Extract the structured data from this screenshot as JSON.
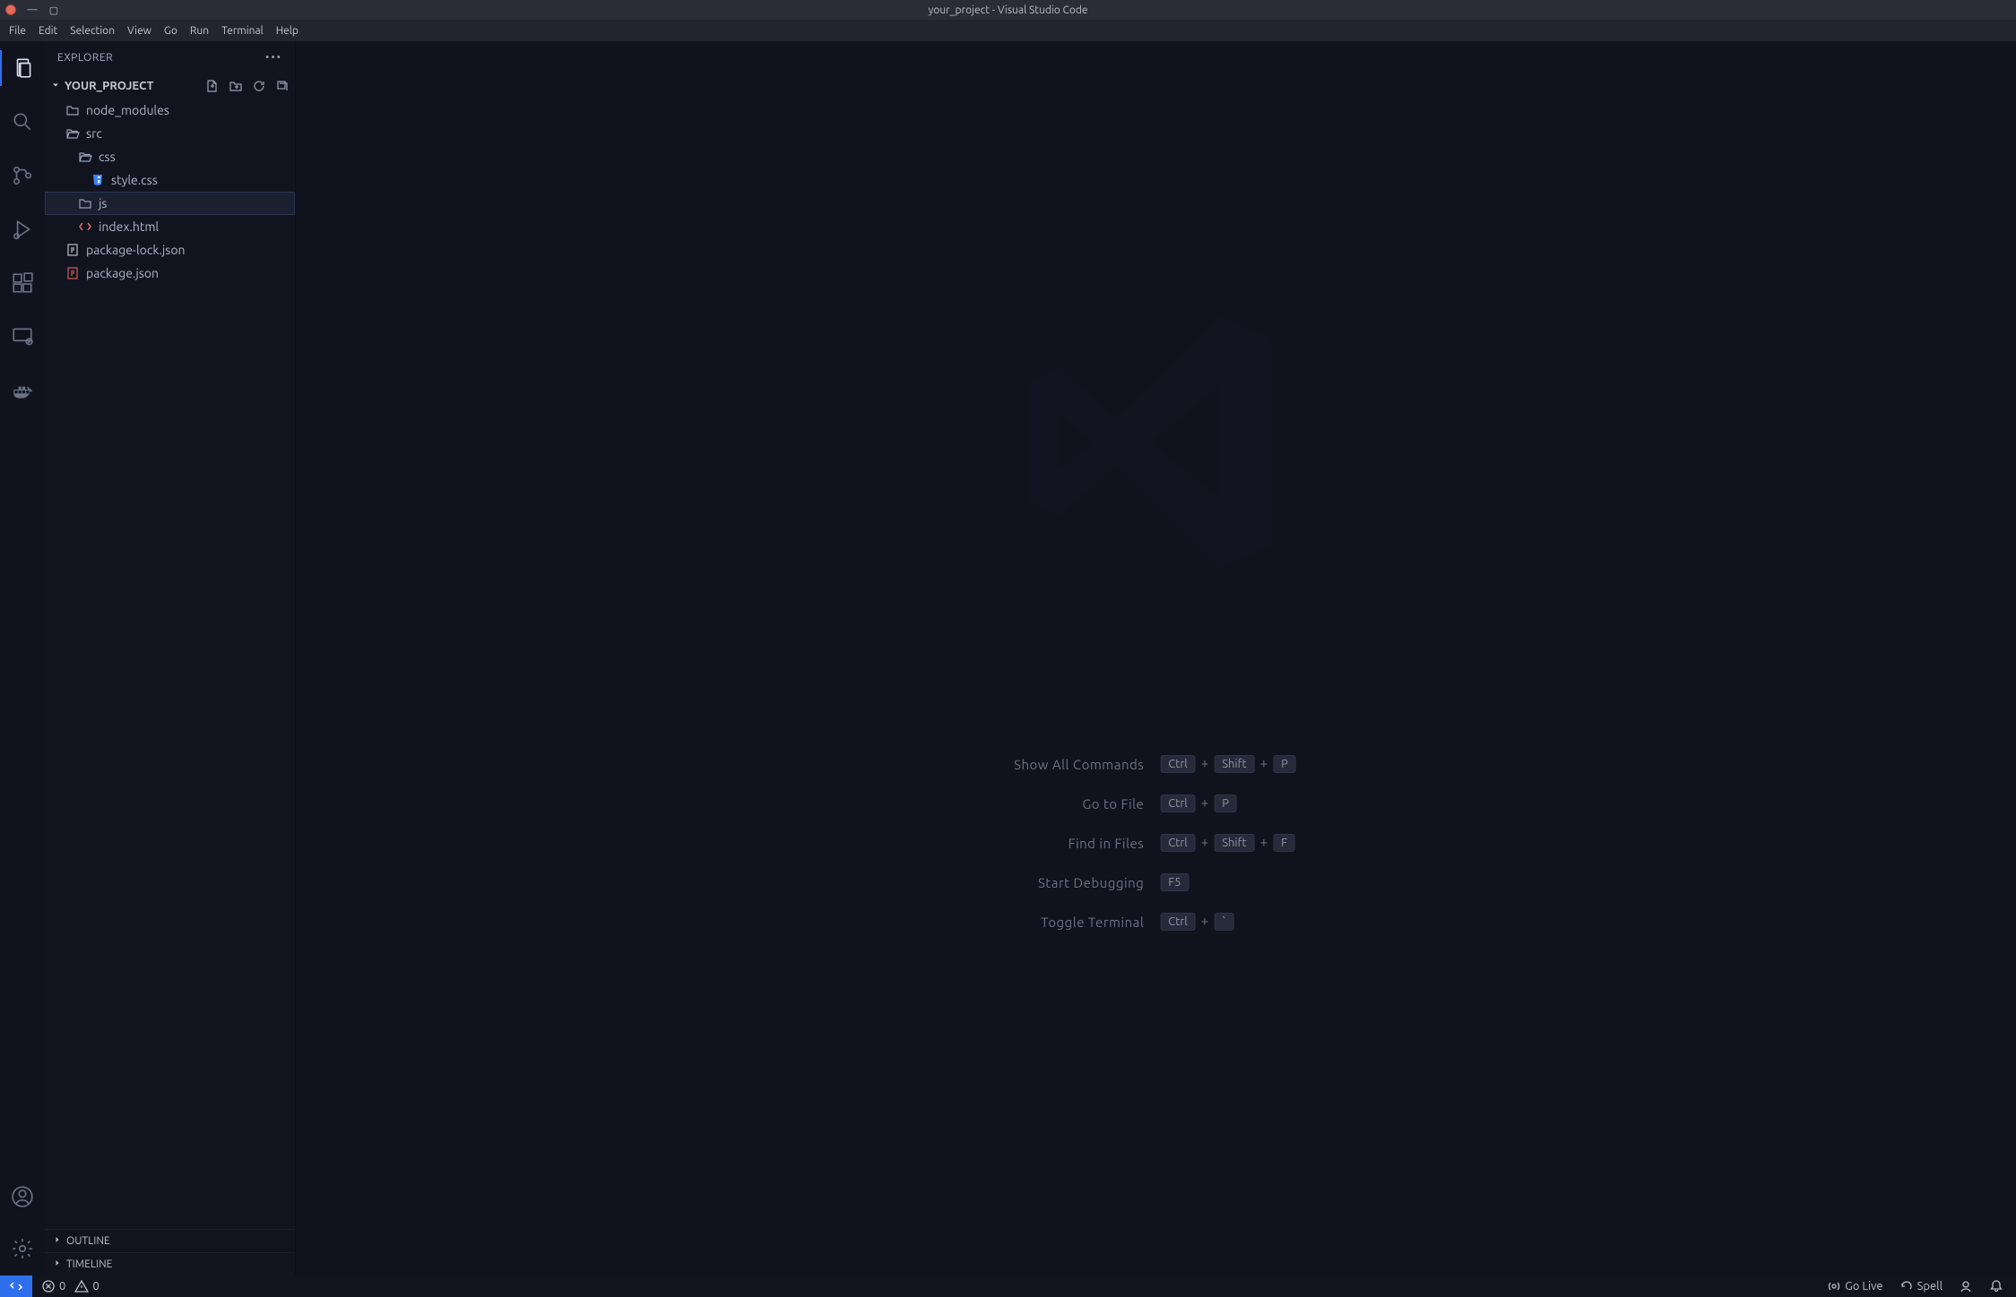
{
  "window": {
    "title": "your_project - Visual Studio Code"
  },
  "menu": [
    "File",
    "Edit",
    "Selection",
    "View",
    "Go",
    "Run",
    "Terminal",
    "Help"
  ],
  "explorer": {
    "title": "EXPLORER",
    "root": "YOUR_PROJECT",
    "tree": [
      {
        "name": "node_modules",
        "icon": "folder",
        "indent": 1
      },
      {
        "name": "src",
        "icon": "folder-open",
        "indent": 1
      },
      {
        "name": "css",
        "icon": "folder-open",
        "indent": 2
      },
      {
        "name": "style.css",
        "icon": "css",
        "indent": 3
      },
      {
        "name": "js",
        "icon": "folder",
        "indent": 2,
        "selected": true
      },
      {
        "name": "index.html",
        "icon": "html",
        "indent": 2
      },
      {
        "name": "package-lock.json",
        "icon": "json",
        "indent": 1
      },
      {
        "name": "package.json",
        "icon": "npm",
        "indent": 1
      }
    ],
    "sections": {
      "outline": "OUTLINE",
      "timeline": "TIMELINE"
    }
  },
  "welcome": {
    "shortcuts": [
      {
        "label": "Show All Commands",
        "keys": [
          "Ctrl",
          "Shift",
          "P"
        ]
      },
      {
        "label": "Go to File",
        "keys": [
          "Ctrl",
          "P"
        ]
      },
      {
        "label": "Find in Files",
        "keys": [
          "Ctrl",
          "Shift",
          "F"
        ]
      },
      {
        "label": "Start Debugging",
        "keys": [
          "F5"
        ]
      },
      {
        "label": "Toggle Terminal",
        "keys": [
          "Ctrl",
          "`"
        ]
      }
    ]
  },
  "status": {
    "errors": "0",
    "warnings": "0",
    "go_live": "Go Live",
    "spell": "Spell"
  }
}
